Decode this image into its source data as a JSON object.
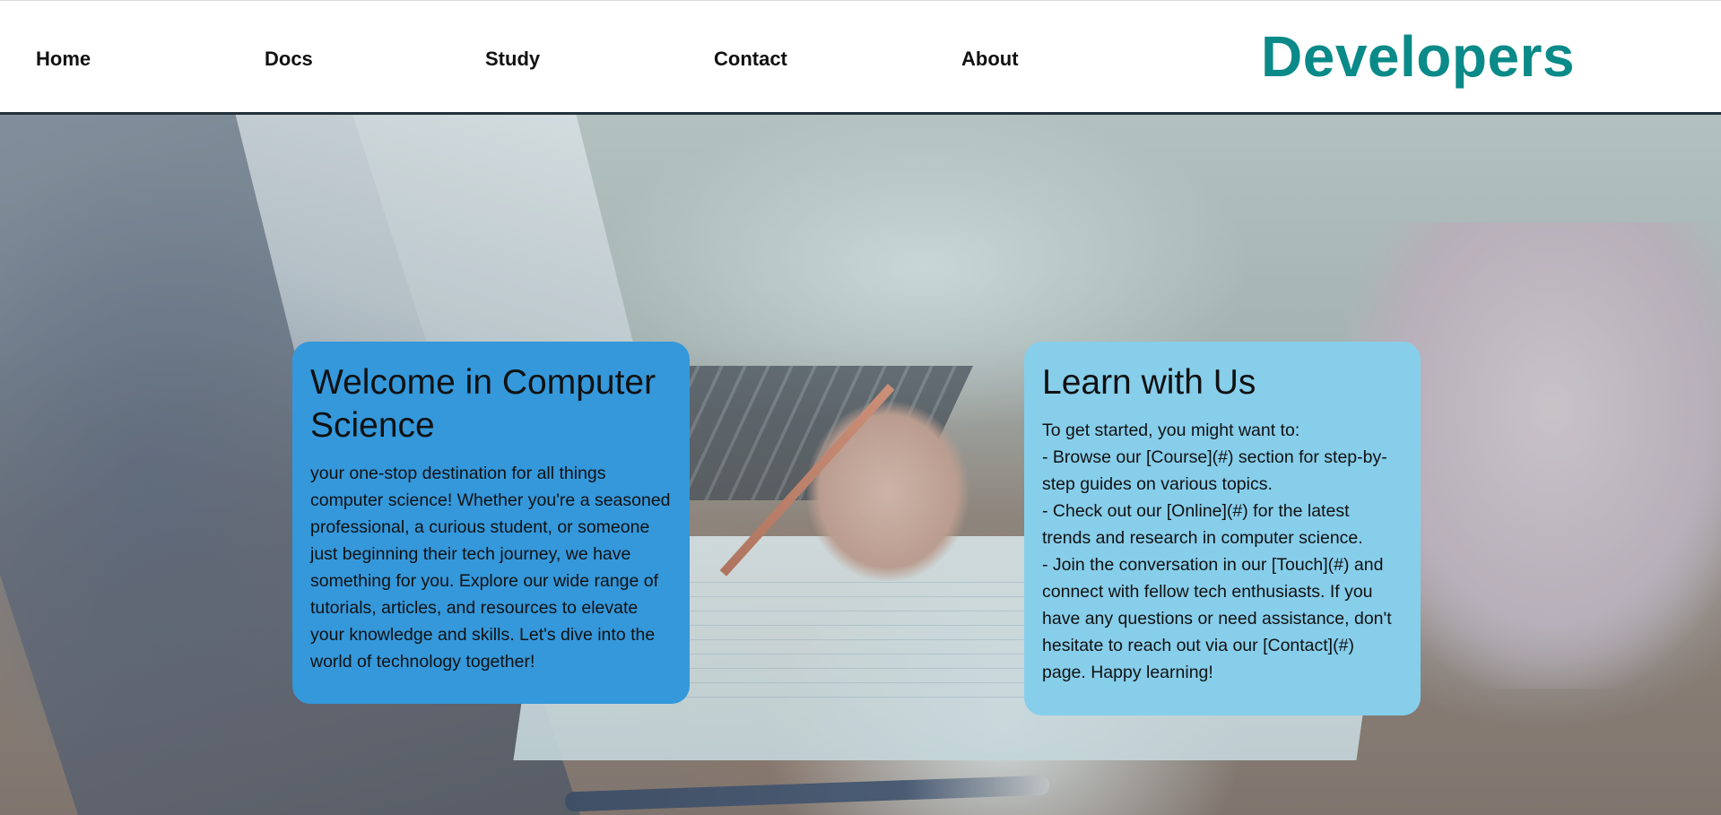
{
  "nav": {
    "home": "Home",
    "docs": "Docs",
    "study": "Study",
    "contact": "Contact",
    "about": "About"
  },
  "brand": {
    "title": "Developers",
    "color": "#0a8a88"
  },
  "cards": {
    "welcome": {
      "title": "Welcome in Computer Science",
      "body": "your one-stop destination for all things computer science! Whether you're a seasoned professional, a curious student, or someone just beginning their tech journey, we have something for you. Explore our wide range of tutorials, articles, and resources to elevate your knowledge and skills. Let's dive into the world of technology together!",
      "color": "#3498db"
    },
    "learn": {
      "title": "Learn with Us",
      "lines": [
        "To get started, you might want to:",
        "- Browse our [Course](#) section for step-by-step guides on various topics.",
        "- Check out our [Online](#) for the latest trends and research in computer science.",
        "- Join the conversation in our [Touch](#) and connect with fellow tech enthusiasts. If you have any questions or need assistance, don't hesitate to reach out via our [Contact](#) page. Happy learning!"
      ],
      "color": "#87ceeb"
    }
  },
  "hero": {
    "image_semantic": "laptop-workspace-photo"
  }
}
